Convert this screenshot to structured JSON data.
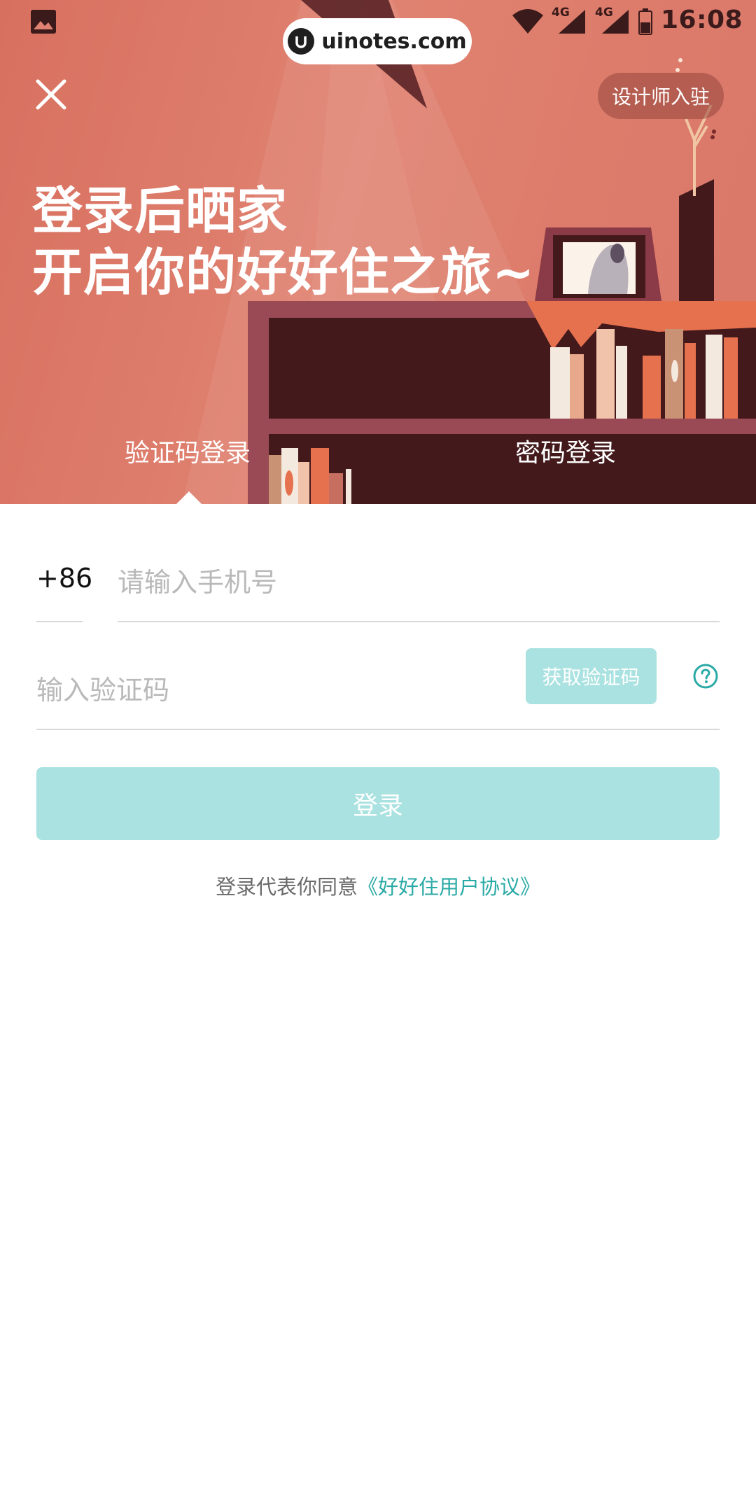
{
  "status_bar": {
    "network_a": "4G",
    "network_b": "4G",
    "time": "16:08"
  },
  "watermark": {
    "text": "uinotes.com"
  },
  "header": {
    "close_icon": "close-icon",
    "designer_label": "设计师入驻",
    "title_line1": "登录后晒家",
    "title_line2": "开启你的好好住之旅~"
  },
  "tabs": [
    {
      "label": "验证码登录",
      "active": true
    },
    {
      "label": "密码登录",
      "active": false
    }
  ],
  "form": {
    "country_code": "+86",
    "phone_placeholder": "请输入手机号",
    "code_placeholder": "输入验证码",
    "get_code_label": "获取验证码",
    "login_label": "登录"
  },
  "agreement": {
    "prefix": "登录代表你同意",
    "link": "《好好住用户协议》"
  },
  "colors": {
    "accent": "#2aaaa6",
    "button_disabled": "#a9e2e0",
    "hero": "#dd7c6b",
    "shelf_dark": "#43191b"
  }
}
